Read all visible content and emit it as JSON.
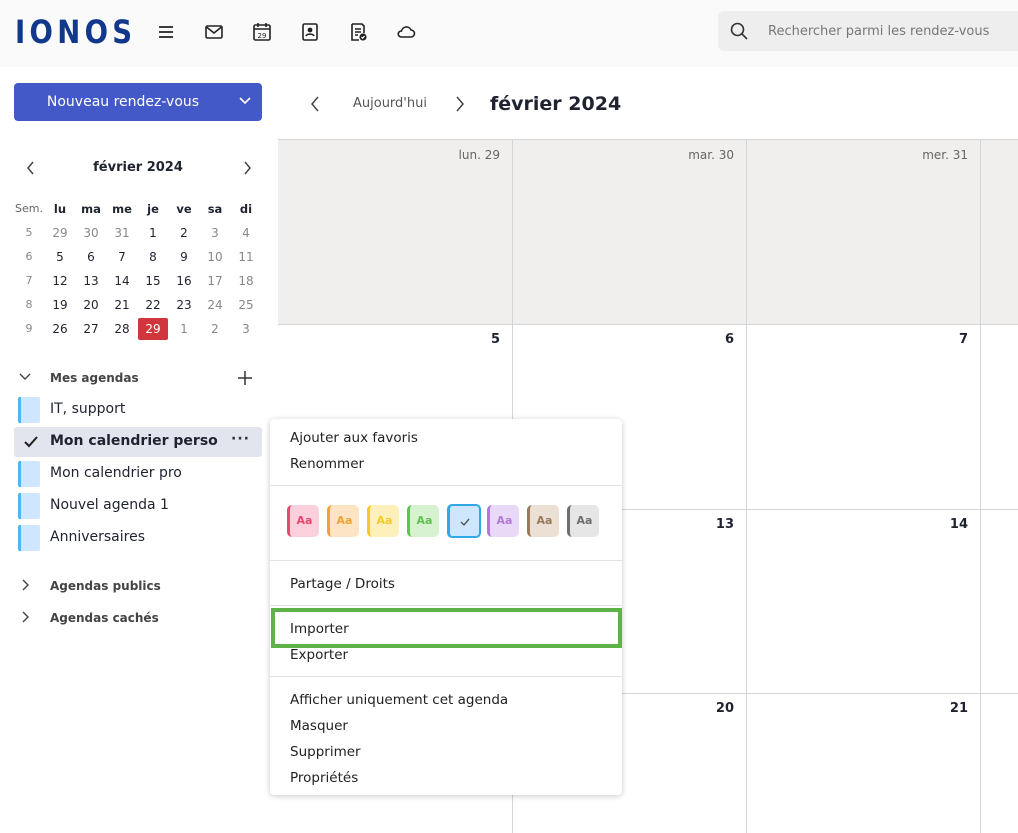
{
  "app": {
    "logo": "IONOS"
  },
  "topbar": {
    "icons": [
      "menu-icon",
      "mail-icon",
      "calendar-icon",
      "contacts-icon",
      "tasks-icon",
      "cloud-icon"
    ],
    "calendar_icon_day": "29",
    "search_placeholder": "Rechercher parmi les rendez-vous"
  },
  "sidebar": {
    "new_button": "Nouveau rendez-vous",
    "mini_calendar": {
      "title": "février 2024",
      "weekday_headers": [
        "Sem.",
        "lu",
        "ma",
        "me",
        "je",
        "ve",
        "sa",
        "di"
      ],
      "weeks": [
        {
          "week": "5",
          "days": [
            "29",
            "30",
            "31",
            "1",
            "2",
            "3",
            "4"
          ]
        },
        {
          "week": "6",
          "days": [
            "5",
            "6",
            "7",
            "8",
            "9",
            "10",
            "11"
          ]
        },
        {
          "week": "7",
          "days": [
            "12",
            "13",
            "14",
            "15",
            "16",
            "17",
            "18"
          ]
        },
        {
          "week": "8",
          "days": [
            "19",
            "20",
            "21",
            "22",
            "23",
            "24",
            "25"
          ]
        },
        {
          "week": "9",
          "days": [
            "26",
            "27",
            "28",
            "29",
            "1",
            "2",
            "3"
          ]
        }
      ],
      "today": "29"
    },
    "my_calendars_label": "Mes agendas",
    "calendars": [
      {
        "label": "IT, support"
      },
      {
        "label": "Mon calendrier perso",
        "active": true
      },
      {
        "label": "Mon calendrier pro"
      },
      {
        "label": "Nouvel agenda 1"
      },
      {
        "label": "Anniversaires"
      }
    ],
    "more_label": "···",
    "public_calendars_label": "Agendas publics",
    "hidden_calendars_label": "Agendas cachés"
  },
  "main": {
    "today_button": "Aujourd'hui",
    "month_title": "février 2024",
    "week1": [
      "lun. 29",
      "mar. 30",
      "mer. 31"
    ],
    "week2": [
      "5",
      "6",
      "7"
    ],
    "week3": [
      "13",
      "14"
    ],
    "week4": [
      "20",
      "21"
    ]
  },
  "context_menu": {
    "add_favorites": "Ajouter aux favoris",
    "rename": "Renommer",
    "swatch_text": "Aa",
    "swatch_colors": [
      "#e8476f",
      "#f2a233",
      "#f4c928",
      "#5ec24d",
      "#30a9e6",
      "#b278d8",
      "#9b7a5c",
      "#6e6e6e"
    ],
    "swatch_bgs": [
      "#fbd0dc",
      "#fde4c4",
      "#fdf0bb",
      "#d7f2d0",
      "#cfe6ff",
      "#ead9f6",
      "#ece0d4",
      "#e6e6e6"
    ],
    "selected_swatch": 4,
    "share": "Partage / Droits",
    "import": "Importer",
    "export": "Exporter",
    "show_only": "Afficher uniquement cet agenda",
    "hide": "Masquer",
    "delete": "Supprimer",
    "properties": "Propriétés"
  },
  "colors": {
    "brand": "#11388c",
    "primary_button": "#4459c8",
    "today": "#d0363b",
    "highlight": "#5fb14a"
  }
}
